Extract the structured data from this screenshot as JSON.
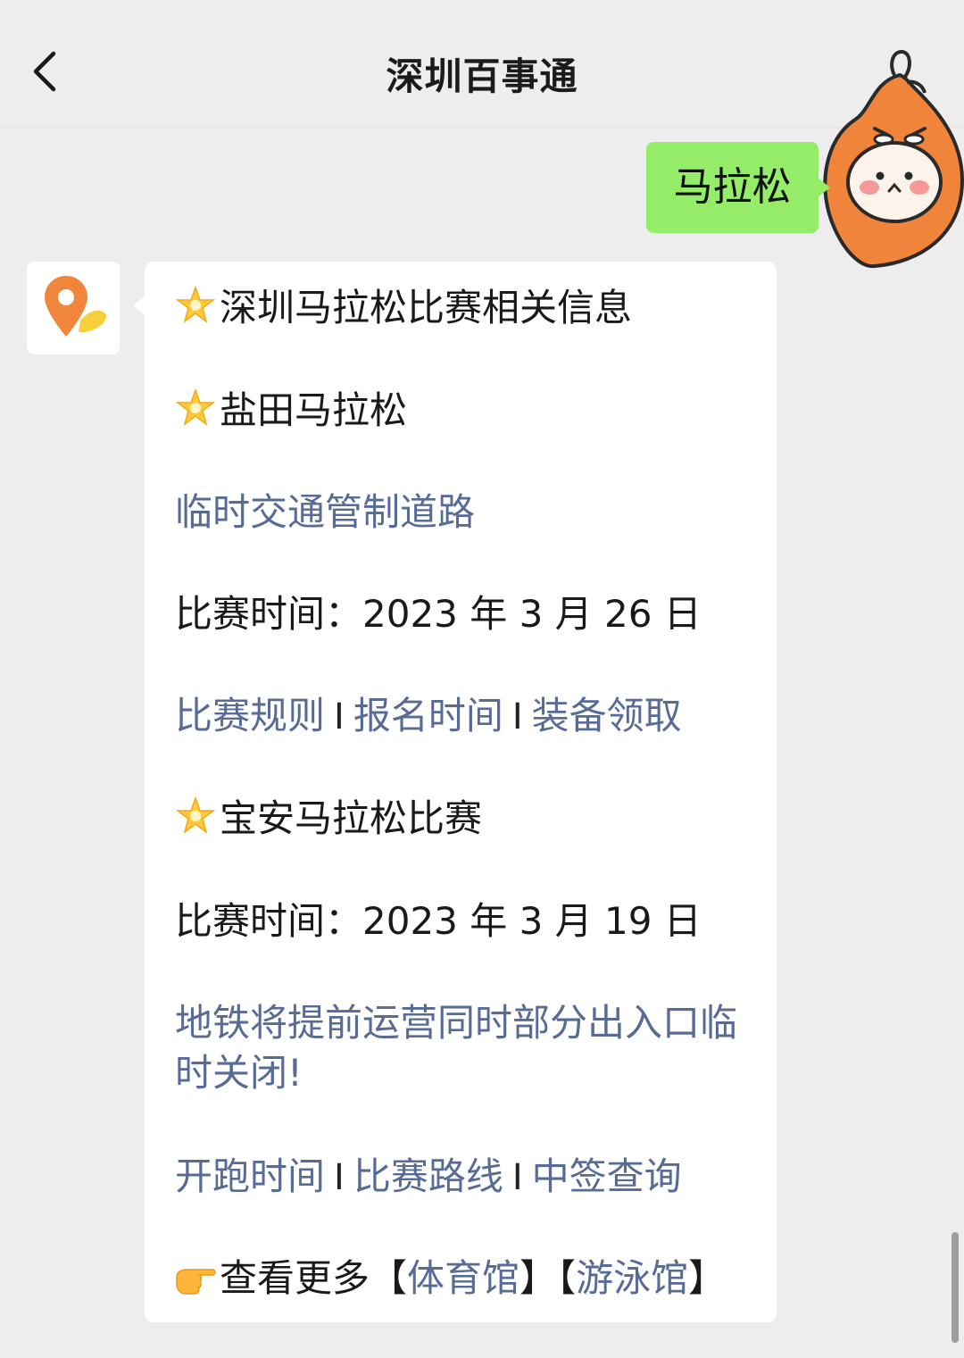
{
  "header": {
    "title": "深圳百事通"
  },
  "conversation": {
    "user_message": "马拉松",
    "bot": {
      "heading_1": "深圳马拉松比赛相关信息",
      "heading_2": "盐田马拉松",
      "link_traffic_control": "临时交通管制道路",
      "date_line_1": "比赛时间：2023 年 3 月 26 日",
      "links_row_1": [
        "比赛规则",
        "报名时间",
        "装备领取"
      ],
      "heading_3": "宝安马拉松比赛",
      "date_line_2": "比赛时间：2023 年 3 月 19 日",
      "link_metro_line_1": "地铁将提前运营同时部分出入口临",
      "link_metro_line_2": "时关闭!",
      "links_row_2": [
        "开跑时间",
        "比赛路线",
        "中签查询"
      ],
      "separator": "I",
      "more_prefix": "查看更多",
      "more_bracket_open": "【",
      "more_bracket_close": "】",
      "more_link_1": "体育馆",
      "more_link_2": "游泳馆"
    }
  },
  "icons": {
    "back": "chevron-left-icon",
    "star": "glowing-star-icon",
    "pointing_hand": "pointing-hand-icon",
    "location_pin": "location-pin-icon"
  },
  "colors": {
    "background": "#ededed",
    "user_bubble": "#95ec69",
    "bot_bubble": "#ffffff",
    "link": "#576b95",
    "pin_orange": "#f0863c",
    "avatar_orange": "#f0843a"
  }
}
